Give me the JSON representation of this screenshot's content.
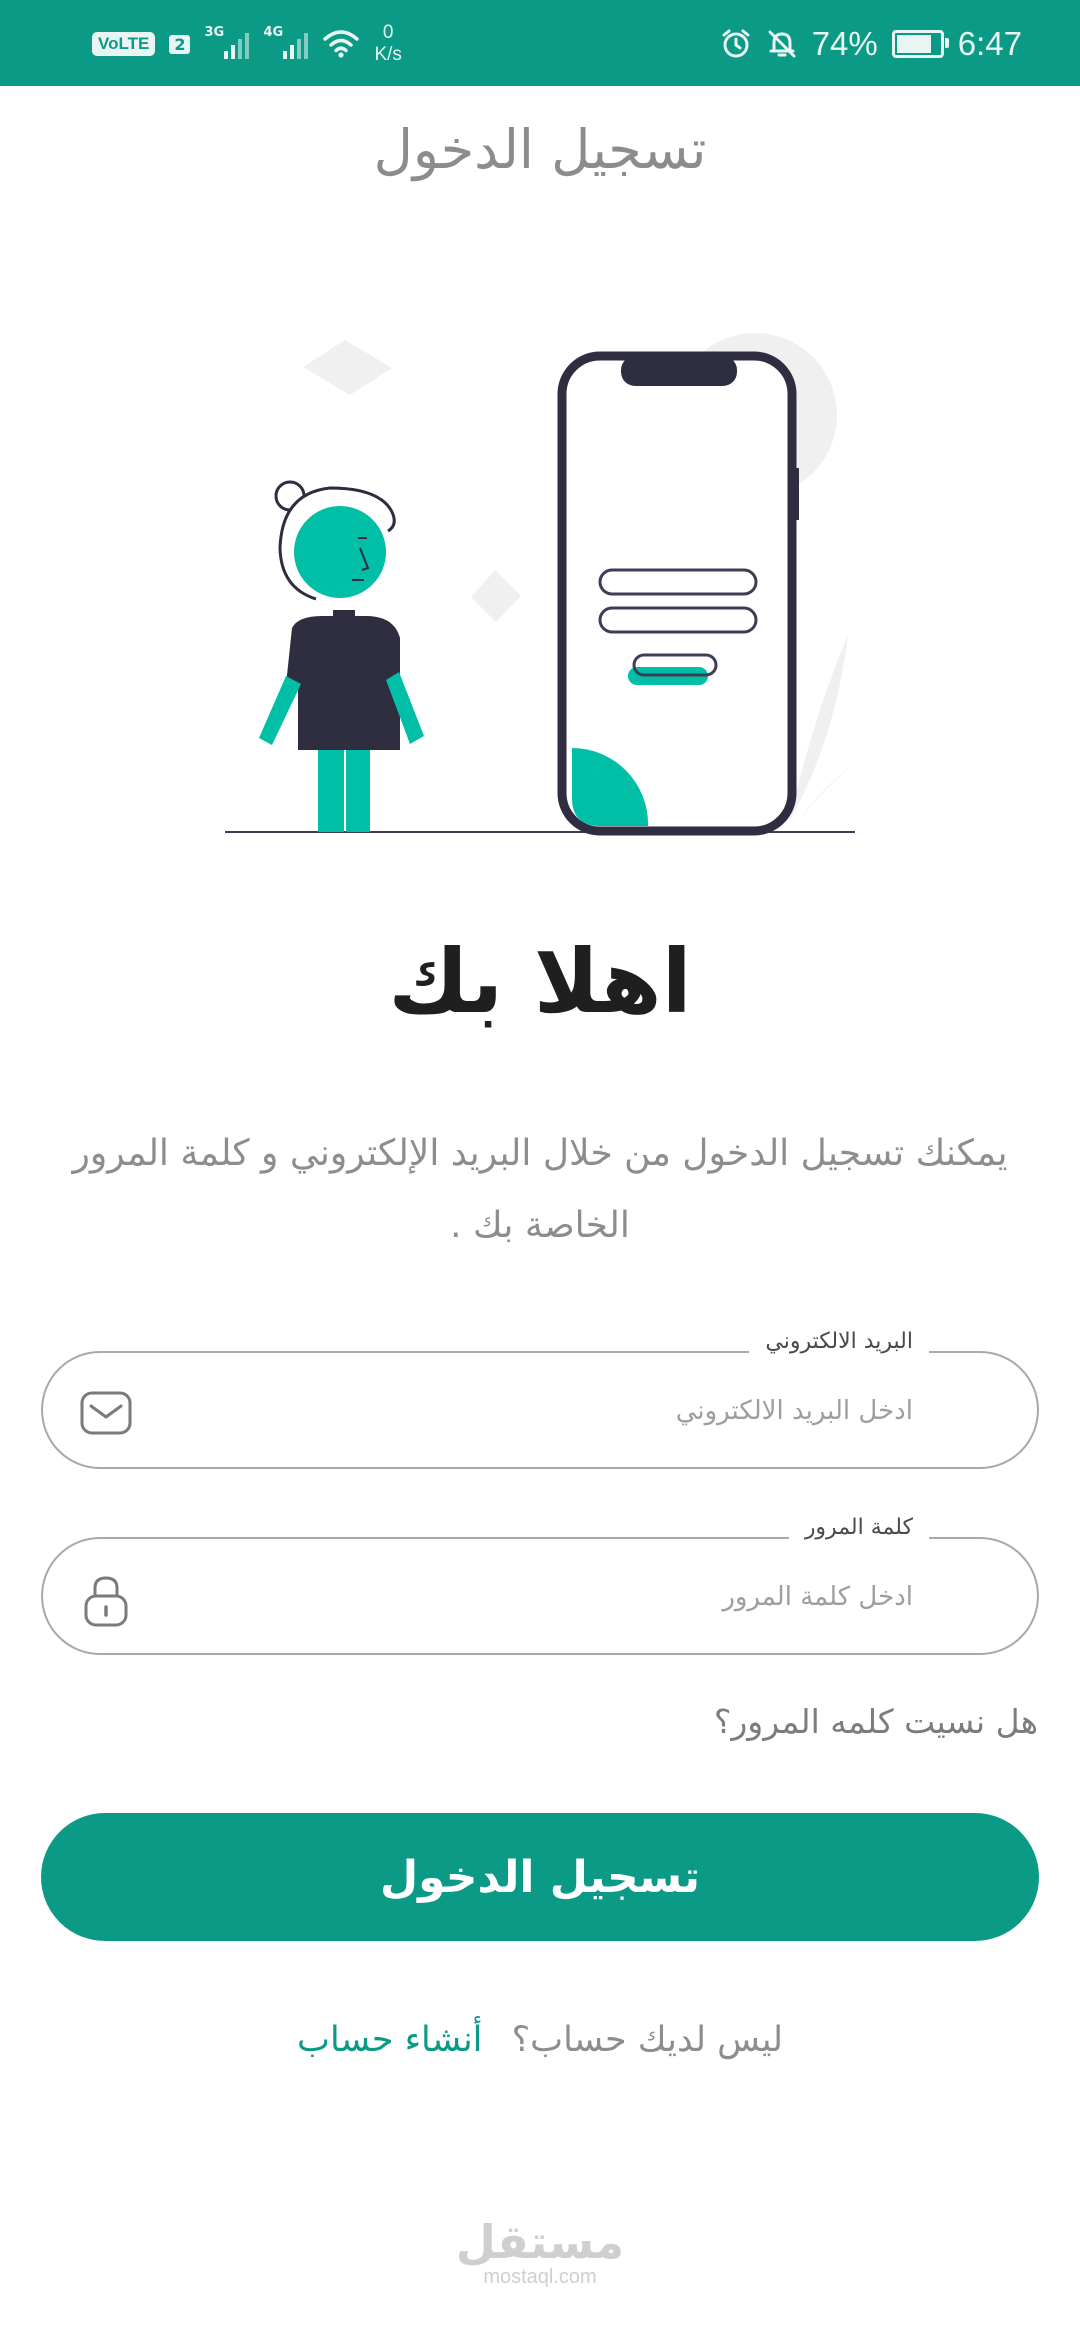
{
  "status_bar": {
    "volte": "VoLTE",
    "sim_index": "2",
    "net1": "3G",
    "net2": "4G",
    "speed_value": "0",
    "speed_unit": "K/s",
    "battery": "74%",
    "time": "6:47",
    "icons": [
      "wifi-icon",
      "alarm-icon",
      "mute-icon",
      "battery-icon"
    ]
  },
  "page": {
    "title": "تسجيل الدخول"
  },
  "welcome": {
    "heading": "اهلا بك",
    "subtitle": "يمكنك تسجيل الدخول من خلال البريد الإلكتروني و كلمة المرور الخاصة بك ."
  },
  "form": {
    "email": {
      "label": "البريد الالكتروني",
      "placeholder": "ادخل البريد الالكتروني",
      "value": "",
      "icon": "mail-icon"
    },
    "password": {
      "label": "كلمة المرور",
      "placeholder": "ادخل كلمة المرور",
      "value": "",
      "icon": "lock-icon"
    },
    "forgot": "هل نسيت كلمه المرور؟",
    "submit": "تسجيل الدخول"
  },
  "signup": {
    "question": "ليس لديك حساب؟",
    "link": "أنشاء حساب"
  },
  "watermark": {
    "logo": "مستقل",
    "url": "mostaql.com"
  },
  "colors": {
    "primary": "#0b9a86",
    "accent": "#00bfa6",
    "dark": "#2f2e41",
    "muted": "#8d8d8d"
  }
}
